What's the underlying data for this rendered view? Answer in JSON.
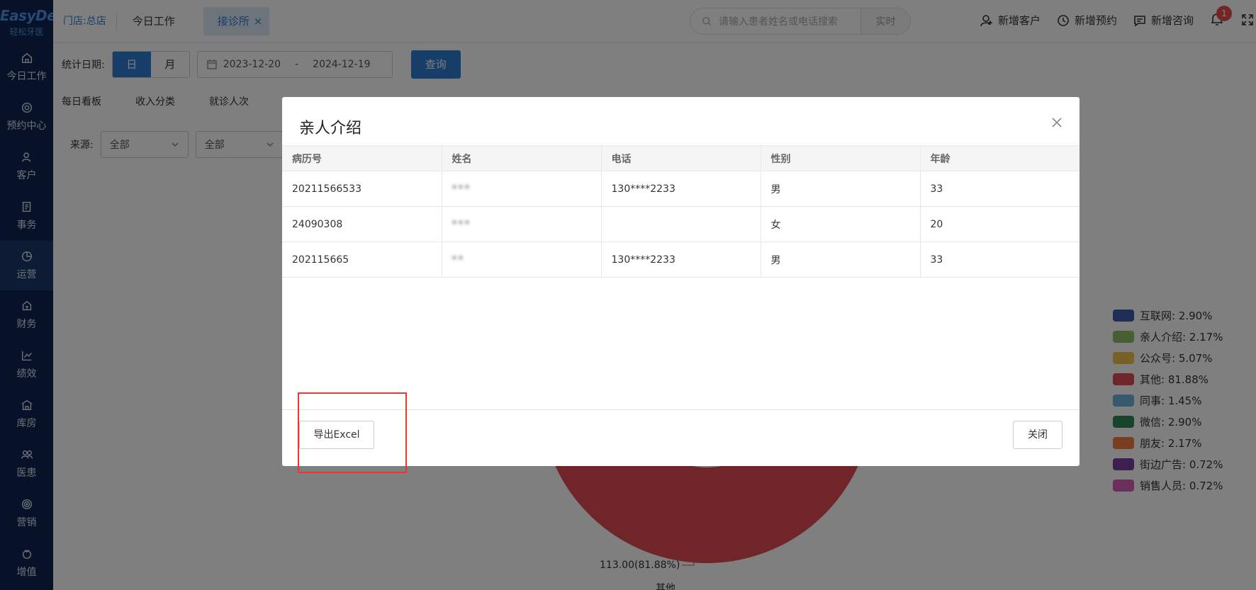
{
  "brand": {
    "logo_line1": "EasyDent",
    "logo_line2": "轻松牙医"
  },
  "sidebar": {
    "items": [
      {
        "label": "今日工作",
        "icon": "home-icon"
      },
      {
        "label": "预约中心",
        "icon": "appointment-icon"
      },
      {
        "label": "客户",
        "icon": "user-icon"
      },
      {
        "label": "事务",
        "icon": "task-icon"
      },
      {
        "label": "运营",
        "icon": "pie-chart-icon",
        "active": true
      },
      {
        "label": "财务",
        "icon": "finance-icon"
      },
      {
        "label": "绩效",
        "icon": "trend-icon"
      },
      {
        "label": "库房",
        "icon": "warehouse-icon"
      },
      {
        "label": "医患",
        "icon": "people-icon"
      },
      {
        "label": "营销",
        "icon": "target-icon"
      },
      {
        "label": "增值",
        "icon": "value-icon"
      }
    ]
  },
  "header": {
    "store_label": "门店:",
    "store_name": "总店",
    "tabs": [
      {
        "label": "今日工作"
      },
      {
        "label": "接诊所",
        "active": true,
        "close": "×"
      }
    ],
    "search_placeholder": "请输入患者姓名或电话搜索",
    "realtime_label": "实时",
    "actions": {
      "new_customer": "新增客户",
      "new_appointment": "新增预约",
      "new_consult": "新增咨询"
    },
    "notification_count": "1"
  },
  "filters": {
    "date_label": "统计日期:",
    "seg_day": "日",
    "seg_month": "月",
    "date_start": "2023-12-20",
    "date_sep": "-",
    "date_end": "2024-12-19",
    "query_button": "查询",
    "subtabs": [
      "每日看板",
      "收入分类",
      "就诊人次"
    ],
    "source_label": "来源:",
    "select1": "全部",
    "select2": "全部"
  },
  "chart_data": {
    "type": "pie",
    "series": [
      {
        "name": "互联网",
        "percent": 2.9,
        "color": "#3c5aa6"
      },
      {
        "name": "亲人介绍",
        "percent": 2.17,
        "color": "#8cc168"
      },
      {
        "name": "公众号",
        "percent": 5.07,
        "color": "#f2c04b"
      },
      {
        "name": "其他",
        "percent": 81.88,
        "color": "#e04a53"
      },
      {
        "name": "同事",
        "percent": 1.45,
        "color": "#6cb4d8"
      },
      {
        "name": "微信",
        "percent": 2.9,
        "color": "#2e8b57"
      },
      {
        "name": "朋友",
        "percent": 2.17,
        "color": "#f07c3e"
      },
      {
        "name": "街边广告",
        "percent": 0.72,
        "color": "#7b3f9e"
      },
      {
        "name": "销售人员",
        "percent": 0.72,
        "color": "#d95fb8"
      }
    ],
    "legend_text": [
      "互联网: 2.90%",
      "亲人介绍: 2.17%",
      "公众号: 5.07%",
      "其他: 81.88%",
      "同事: 1.45%",
      "微信: 2.90%",
      "朋友: 2.17%",
      "街边广告: 0.72%",
      "销售人员: 0.72%"
    ],
    "data_label": "113.00(81.88%)",
    "data_label_name": "其他",
    "legend_position": "right"
  },
  "modal": {
    "title": "亲人介绍",
    "columns": [
      "病历号",
      "姓名",
      "电话",
      "性别",
      "年龄"
    ],
    "rows": [
      {
        "id": "20211566533",
        "name": "***",
        "phone": "130****2233",
        "gender": "男",
        "age": "33"
      },
      {
        "id": "24090308",
        "name": "***",
        "phone": "",
        "gender": "女",
        "age": "20"
      },
      {
        "id": "202115665",
        "name": "**",
        "phone": "130****2233",
        "gender": "男",
        "age": "33"
      }
    ],
    "export_button": "导出Excel",
    "close_button": "关闭"
  }
}
